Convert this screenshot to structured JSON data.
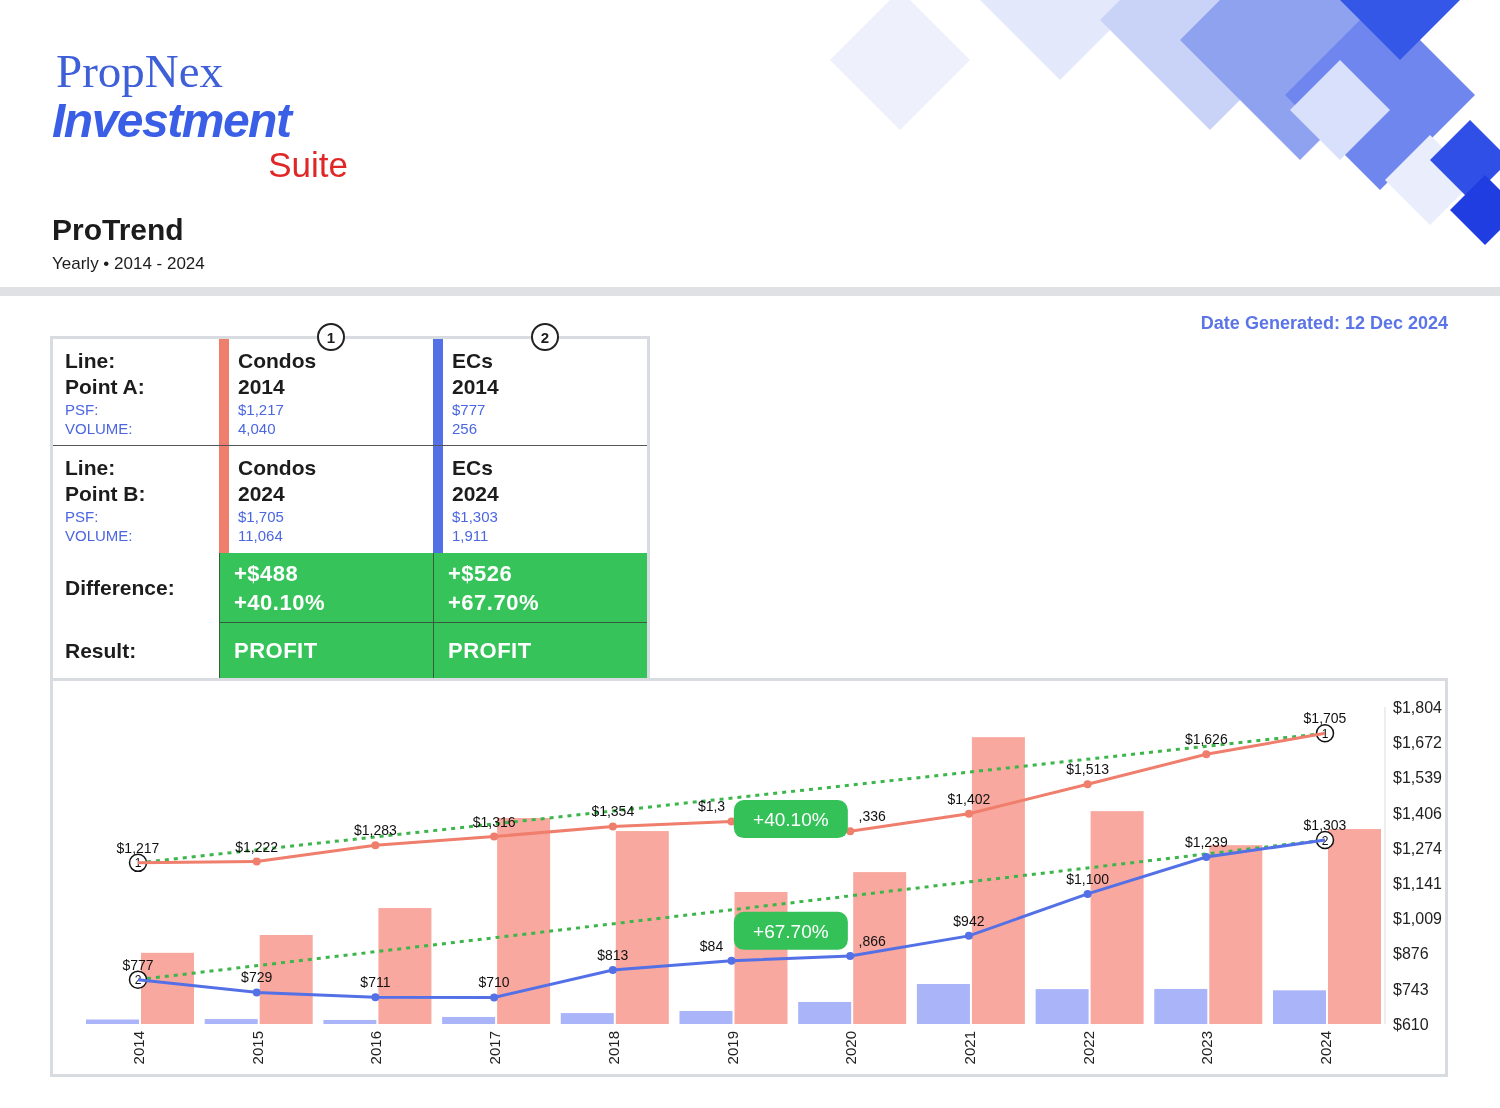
{
  "logo": {
    "line_1": "PropNex",
    "line_2": "Investment",
    "line_3": "Suite"
  },
  "report": {
    "title": "ProTrend",
    "subtitle": "Yearly • 2014 - 2024"
  },
  "date_generated": "Date Generated: 12 Dec 2024",
  "comparison": {
    "columns": [
      {
        "marker": "1",
        "color": "#ef7e6c"
      },
      {
        "marker": "2",
        "color": "#5470e6"
      }
    ],
    "points": [
      {
        "line_label": "Line:",
        "point_label": "Point A:",
        "psf_label": "PSF:",
        "volume_label": "VOLUME:",
        "cells": [
          {
            "line": "Condos",
            "year": "2014",
            "psf": "$1,217",
            "volume": "4,040"
          },
          {
            "line": "ECs",
            "year": "2014",
            "psf": "$777",
            "volume": "256"
          }
        ]
      },
      {
        "line_label": "Line:",
        "point_label": "Point B:",
        "psf_label": "PSF:",
        "volume_label": "VOLUME:",
        "cells": [
          {
            "line": "Condos",
            "year": "2024",
            "psf": "$1,705",
            "volume": "11,064"
          },
          {
            "line": "ECs",
            "year": "2024",
            "psf": "$1,303",
            "volume": "1,911"
          }
        ]
      }
    ],
    "difference": {
      "label": "Difference:",
      "cells": [
        {
          "amount": "+$488",
          "percent": "+40.10%"
        },
        {
          "amount": "+$526",
          "percent": "+67.70%"
        }
      ]
    },
    "result": {
      "label": "Result:",
      "cells": [
        "PROFIT",
        "PROFIT"
      ]
    }
  },
  "chart": {
    "trend_lines": [
      {
        "color": "#3cb54a",
        "badge": "+40.10%",
        "start_marker": "1",
        "end_marker": "1"
      },
      {
        "color": "#3cb54a",
        "badge": "+67.70%",
        "start_marker": "2",
        "end_marker": "2"
      }
    ],
    "cut_labels": [
      "$1,3",
      ",336",
      "$84",
      ",866"
    ],
    "chart_data": {
      "type": "line",
      "categories": [
        "2014",
        "2015",
        "2016",
        "2017",
        "2018",
        "2019",
        "2020",
        "2021",
        "2022",
        "2023",
        "2024"
      ],
      "ylim": [
        610,
        1804
      ],
      "yticks": [
        {
          "value": 610,
          "label": "$610"
        },
        {
          "value": 743,
          "label": "$743"
        },
        {
          "value": 876,
          "label": "$876"
        },
        {
          "value": 1009,
          "label": "$1,009"
        },
        {
          "value": 1141,
          "label": "$1,141"
        },
        {
          "value": 1274,
          "label": "$1,274"
        },
        {
          "value": 1406,
          "label": "$1,406"
        },
        {
          "value": 1539,
          "label": "$1,539"
        },
        {
          "value": 1672,
          "label": "$1,672"
        },
        {
          "value": 1804,
          "label": "$1,804"
        }
      ],
      "series": [
        {
          "color": "#ef7e6c",
          "marker": "o",
          "values": [
            1217,
            1222,
            1283,
            1316,
            1354,
            1373,
            1336,
            1402,
            1513,
            1626,
            1705
          ],
          "value_labels": [
            "$1,217",
            "$1,222",
            "$1,283",
            "$1,316",
            "$1,354",
            null,
            null,
            "$1,402",
            "$1,513",
            "$1,626",
            "$1,705"
          ]
        },
        {
          "color": "#5470e6",
          "marker": "o",
          "values": [
            777,
            729,
            711,
            710,
            813,
            848,
            866,
            942,
            1100,
            1239,
            1303
          ],
          "value_labels": [
            "$777",
            "$729",
            "$711",
            "$710",
            "$813",
            null,
            null,
            "$942",
            "$1,100",
            "$1,239",
            "$1,303"
          ]
        }
      ]
    }
  }
}
